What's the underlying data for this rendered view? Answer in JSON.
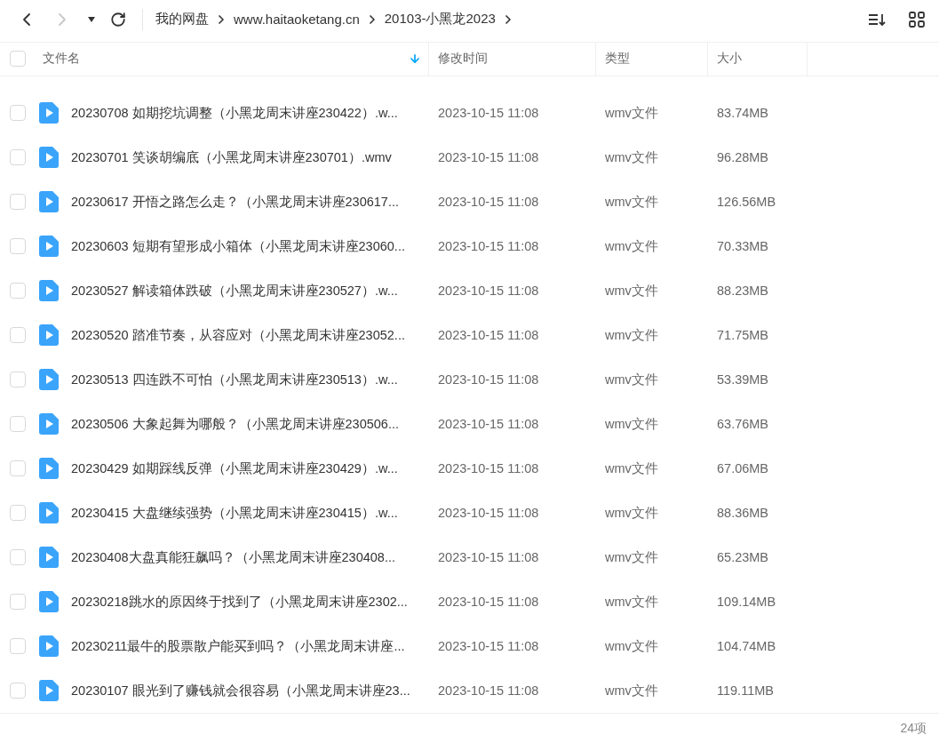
{
  "toolbar": {
    "forward_disabled": true,
    "breadcrumbs": [
      "我的网盘",
      "www.haitaoketang.cn",
      "20103-小黑龙2023"
    ]
  },
  "table": {
    "select_all_checked": false,
    "columns": [
      {
        "label": "文件名",
        "sorted": true
      },
      {
        "label": "修改时间",
        "sorted": false
      },
      {
        "label": "类型",
        "sorted": false
      },
      {
        "label": "大小",
        "sorted": false
      }
    ],
    "rows": [
      {
        "name": "20230708 如期挖坑调整（小黑龙周末讲座230422）.w...",
        "modified": "2023-10-15 11:08",
        "type": "wmv文件",
        "size": "83.74MB",
        "checked": false
      },
      {
        "name": "20230701 笑谈胡编底（小黑龙周末讲座230701）.wmv",
        "modified": "2023-10-15 11:08",
        "type": "wmv文件",
        "size": "96.28MB",
        "checked": false
      },
      {
        "name": "20230617 开悟之路怎么走？（小黑龙周末讲座230617...",
        "modified": "2023-10-15 11:08",
        "type": "wmv文件",
        "size": "126.56MB",
        "checked": false
      },
      {
        "name": "20230603 短期有望形成小箱体（小黑龙周末讲座23060...",
        "modified": "2023-10-15 11:08",
        "type": "wmv文件",
        "size": "70.33MB",
        "checked": false
      },
      {
        "name": "20230527 解读箱体跌破（小黑龙周末讲座230527）.w...",
        "modified": "2023-10-15 11:08",
        "type": "wmv文件",
        "size": "88.23MB",
        "checked": false
      },
      {
        "name": "20230520 踏准节奏，从容应对（小黑龙周末讲座23052...",
        "modified": "2023-10-15 11:08",
        "type": "wmv文件",
        "size": "71.75MB",
        "checked": false
      },
      {
        "name": "20230513 四连跌不可怕（小黑龙周末讲座230513）.w...",
        "modified": "2023-10-15 11:08",
        "type": "wmv文件",
        "size": "53.39MB",
        "checked": false
      },
      {
        "name": "20230506 大象起舞为哪般？（小黑龙周末讲座230506...",
        "modified": "2023-10-15 11:08",
        "type": "wmv文件",
        "size": "63.76MB",
        "checked": false
      },
      {
        "name": "20230429 如期踩线反弹（小黑龙周末讲座230429）.w...",
        "modified": "2023-10-15 11:08",
        "type": "wmv文件",
        "size": "67.06MB",
        "checked": false
      },
      {
        "name": "20230415 大盘继续强势（小黑龙周末讲座230415）.w...",
        "modified": "2023-10-15 11:08",
        "type": "wmv文件",
        "size": "88.36MB",
        "checked": false
      },
      {
        "name": "20230408大盘真能狂飙吗？（小黑龙周末讲座230408...",
        "modified": "2023-10-15 11:08",
        "type": "wmv文件",
        "size": "65.23MB",
        "checked": false
      },
      {
        "name": "20230218跳水的原因终于找到了（小黑龙周末讲座2302...",
        "modified": "2023-10-15 11:08",
        "type": "wmv文件",
        "size": "109.14MB",
        "checked": false
      },
      {
        "name": "20230211最牛的股票散户能买到吗？（小黑龙周末讲座...",
        "modified": "2023-10-15 11:08",
        "type": "wmv文件",
        "size": "104.74MB",
        "checked": false
      },
      {
        "name": "20230107 眼光到了赚钱就会很容易（小黑龙周末讲座23...",
        "modified": "2023-10-15 11:08",
        "type": "wmv文件",
        "size": "119.11MB",
        "checked": false
      }
    ]
  },
  "status_bar": {
    "count": "24项"
  }
}
